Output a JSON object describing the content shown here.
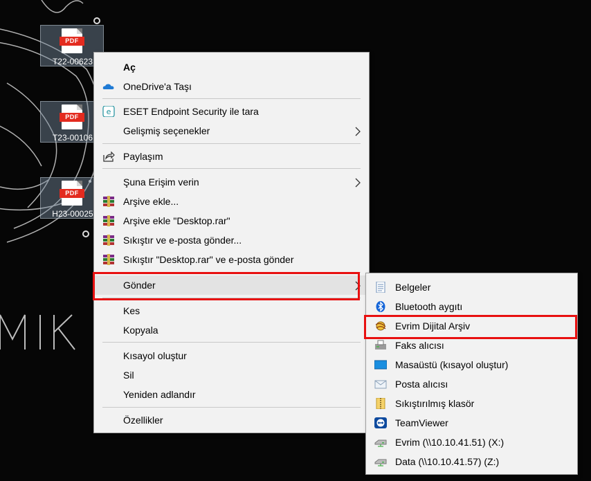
{
  "desktop": {
    "wallpaper_text": "MIK",
    "icons": [
      {
        "type": "PDF",
        "label": "T22-00623"
      },
      {
        "type": "PDF",
        "label": "T23-00106"
      },
      {
        "type": "PDF",
        "label": "H23-00025"
      }
    ]
  },
  "context_menu": {
    "items": [
      {
        "label": "Aç",
        "icon": "none"
      },
      {
        "label": "OneDrive'a Taşı",
        "icon": "onedrive-icon"
      },
      {
        "label": "ESET Endpoint Security ile tara",
        "icon": "eset-icon"
      },
      {
        "label": "Gelişmiş seçenekler",
        "icon": "none"
      },
      {
        "label": "Paylaşım",
        "icon": "share-icon"
      },
      {
        "label": "Şuna Erişim verin",
        "icon": "none"
      },
      {
        "label": "Arşive ekle...",
        "icon": "winrar-icon"
      },
      {
        "label": "Arşive ekle \"Desktop.rar\"",
        "icon": "winrar-icon"
      },
      {
        "label": "Sıkıştır ve e-posta gönder...",
        "icon": "winrar-icon"
      },
      {
        "label": "Sıkıştır \"Desktop.rar\" ve e-posta gönder",
        "icon": "winrar-icon"
      },
      {
        "label": "Gönder",
        "icon": "none"
      },
      {
        "label": "Kes",
        "icon": "none"
      },
      {
        "label": "Kopyala",
        "icon": "none"
      },
      {
        "label": "Kısayol oluştur",
        "icon": "none"
      },
      {
        "label": "Sil",
        "icon": "none"
      },
      {
        "label": "Yeniden adlandır",
        "icon": "none"
      },
      {
        "label": "Özellikler",
        "icon": "none"
      }
    ]
  },
  "send_to_menu": {
    "items": [
      {
        "label": "Belgeler",
        "icon": "documents-icon"
      },
      {
        "label": "Bluetooth aygıtı",
        "icon": "bluetooth-icon"
      },
      {
        "label": "Evrim Dijital Arşiv",
        "icon": "archive-app-icon"
      },
      {
        "label": "Faks alıcısı",
        "icon": "fax-icon"
      },
      {
        "label": "Masaüstü (kısayol oluştur)",
        "icon": "desktop-icon"
      },
      {
        "label": "Posta alıcısı",
        "icon": "mail-icon"
      },
      {
        "label": "Sıkıştırılmış klasör",
        "icon": "zip-folder-icon"
      },
      {
        "label": "TeamViewer",
        "icon": "teamviewer-icon"
      },
      {
        "label": "Evrim (\\\\10.10.41.51) (X:)",
        "icon": "network-drive-icon"
      },
      {
        "label": "Data (\\\\10.10.41.57) (Z:)",
        "icon": "network-drive-icon"
      }
    ]
  },
  "colors": {
    "highlight": "#e81010",
    "menu_bg": "#f2f2f2",
    "pdf_red": "#e32b1f"
  }
}
